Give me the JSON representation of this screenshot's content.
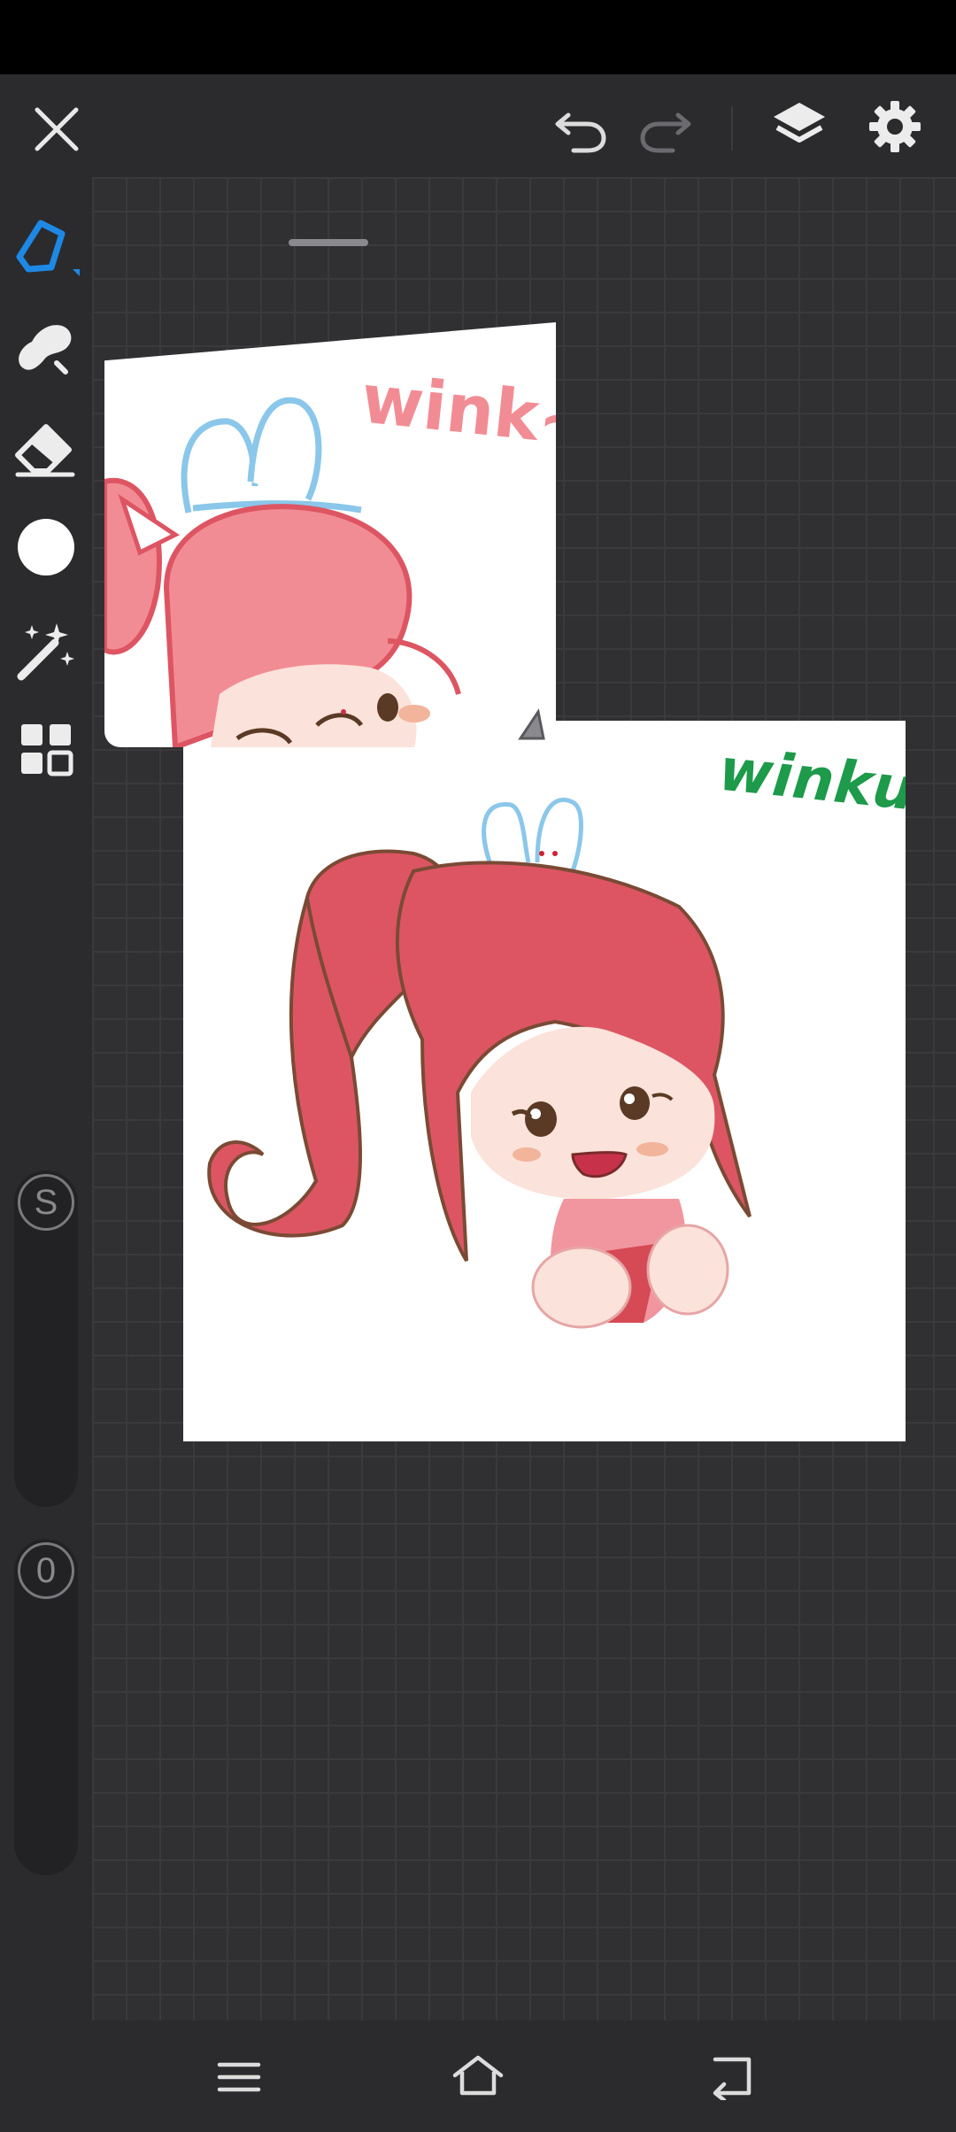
{
  "top_bar": {
    "close_icon": "close-icon",
    "undo_icon": "undo-icon",
    "redo_icon": "redo-icon",
    "layers_icon": "layers-icon",
    "settings_icon": "gear-icon"
  },
  "sidebar": {
    "tools": [
      {
        "name": "pen-tool",
        "icon": "pen-icon",
        "active": true
      },
      {
        "name": "smudge-tool",
        "icon": "smudge-icon"
      },
      {
        "name": "eraser-tool",
        "icon": "eraser-icon"
      },
      {
        "name": "color-picker",
        "icon": "color-circle-icon",
        "color": "#ffffff"
      },
      {
        "name": "magic-wand-tool",
        "icon": "magic-wand-icon"
      },
      {
        "name": "gallery-tool",
        "icon": "grid-icon"
      }
    ],
    "size_slider_label": "S",
    "opacity_slider_label": "0"
  },
  "canvas": {
    "reference_caption": "wink~",
    "drawing_caption": "winku"
  },
  "nav_bar": {
    "menu_icon": "menu-icon",
    "home_icon": "home-icon",
    "back_icon": "back-icon"
  },
  "colors": {
    "accent": "#1e88e5",
    "hair": "#dd5563",
    "bunny_ears": "#8ac7ea",
    "drawing_caption": "#1d9a4a",
    "reference_caption": "#f28c94"
  }
}
